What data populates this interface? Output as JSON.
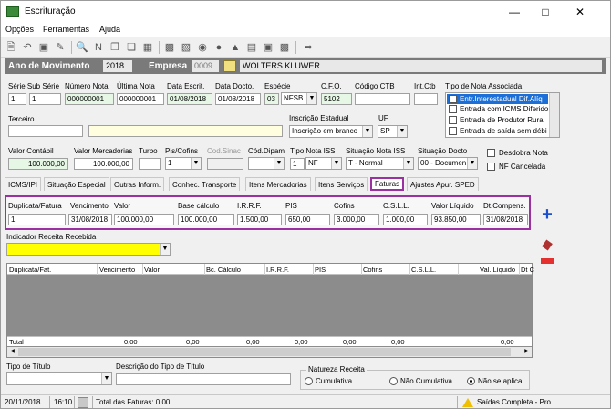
{
  "window": {
    "title": "Escrituração"
  },
  "menu": [
    "Opções",
    "Ferramentas",
    "Ajuda"
  ],
  "year_bar": {
    "ano_label": "Ano de Movimento",
    "ano_value": "2018",
    "empresa_label": "Empresa",
    "empresa_code": "0009",
    "empresa_name": "WOLTERS KLUWER"
  },
  "row1": {
    "serie_label": "Série Sub Série",
    "serie": "1",
    "subserie": "1",
    "numero_label": "Número Nota",
    "numero": "000000001",
    "ultima_label": "Última Nota",
    "ultima": "000000001",
    "data_escrit_label": "Data Escrit.",
    "data_escrit": "01/08/2018",
    "data_docto_label": "Data Docto.",
    "data_docto": "01/08/2018",
    "especie_label": "Espécie",
    "especie_code": "03",
    "especie_value": "NFSB",
    "cfo_label": "C.F.O.",
    "cfo": "5102",
    "codigo_ctb_label": "Código CTB",
    "codigo_ctb": "",
    "int_ctb_label": "Int.Ctb",
    "int_ctb": "",
    "tipo_nota_label": "Tipo de Nota Associada",
    "tipo_nota_items": [
      "Entr.Interestadual Dif.Alíq",
      "Entrada com ICMS Diferido",
      "Entrada de Produtor Rural",
      "Entrada de saída sem débi"
    ]
  },
  "row2": {
    "terceiro_label": "Terceiro",
    "inscricao_label": "Inscrição Estadual",
    "inscricao_value": "Inscrição em branco",
    "uf_label": "UF",
    "uf_value": "SP"
  },
  "row3": {
    "valor_contabil_label": "Valor Contábil",
    "valor_contabil": "100.000,00",
    "valor_mercadorias_label": "Valor Mercadorias",
    "valor_mercadorias": "100.000,00",
    "turbo_label": "Turbo",
    "pis_cofins_label": "Pis/Cofins",
    "pis_cofins": "1",
    "cod_sinac_label": "Cod.Sinac",
    "cod_dipam_label": "Cód.Dipam",
    "tipo_nota_iss_label": "Tipo Nota ISS",
    "tipo_nota_iss_code": "1",
    "tipo_nota_iss_value": "NF",
    "situacao_iss_label": "Situação Nota ISS",
    "situacao_iss_value": "T - Normal",
    "situacao_docto_label": "Situação Docto",
    "situacao_docto_value": "00 - Documen",
    "desdobra_label": "Desdobra Nota",
    "nf_cancelada_label": "NF Cancelada"
  },
  "tabs": [
    "ICMS/IPI",
    "Situação Especial",
    "Outras Inform.",
    "Conhec. Transporte",
    "Itens Mercadorias",
    "Itens Serviços",
    "Faturas",
    "Ajustes Apur. SPED"
  ],
  "faturas": {
    "headers": {
      "duplicata": "Duplicata/Fatura",
      "vencimento": "Vencimento",
      "valor": "Valor",
      "base": "Base cálculo",
      "irrf": "I.R.R.F.",
      "pis": "PIS",
      "cofins": "Cofins",
      "csll": "C.S.L.L.",
      "liquido": "Valor Líquido",
      "dtcomp": "Dt.Compens."
    },
    "values": {
      "duplicata": "1",
      "vencimento": "31/08/2018",
      "valor": "100.000,00",
      "base": "100.000,00",
      "irrf": "1.500,00",
      "pis": "650,00",
      "cofins": "3.000,00",
      "csll": "1.000,00",
      "liquido": "93.850,00",
      "dtcomp": "31/08/2018"
    }
  },
  "indicador_label": "Indicador Receita Recebida",
  "grid": {
    "columns": [
      "Duplicata/Fat.",
      "Vencimento",
      "Valor",
      "Bc. Cálculo",
      "I.R.R.F.",
      "PIS",
      "Cofins",
      "C.S.L.L.",
      "Val. Líquido",
      "Dt C"
    ],
    "total_label": "Total",
    "totals": [
      "0,00",
      "0,00",
      "0,00",
      "0,00",
      "0,00",
      "0,00",
      "0,00"
    ]
  },
  "bottom": {
    "tipo_titulo_label": "Tipo de Título",
    "descricao_label": "Descrição do Tipo de Título",
    "natureza_label": "Natureza Receita",
    "radio_cumulativa": "Cumulativa",
    "radio_nao_cumulativa": "Não Cumulativa",
    "radio_nao_aplica": "Não se aplica"
  },
  "status": {
    "date": "20/11/2018",
    "time": "16:10",
    "total_faturas": "Total das Faturas: 0,00",
    "mode": "Saídas Completa - Pro"
  }
}
